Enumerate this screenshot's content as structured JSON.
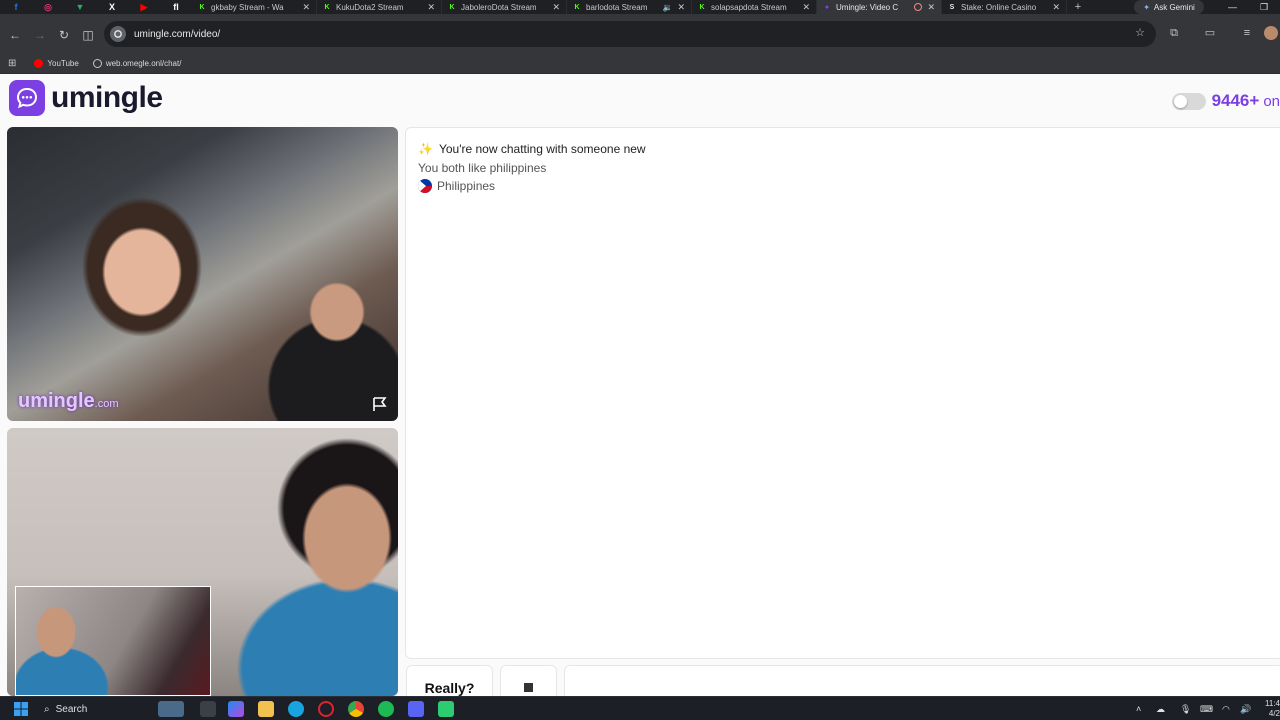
{
  "browser": {
    "pinned_tabs": [
      {
        "icon": "facebook-icon",
        "glyph": "f",
        "color": "#1877f2"
      },
      {
        "icon": "instagram-icon",
        "glyph": "◎",
        "color": "#e1306c"
      },
      {
        "icon": "vpn-shield-icon",
        "glyph": "▼",
        "color": "#27ae60"
      },
      {
        "icon": "x-icon",
        "glyph": "X",
        "color": "#ffffff"
      },
      {
        "icon": "youtube-icon",
        "glyph": "▶",
        "color": "#ff0000"
      },
      {
        "icon": "fb-page-icon",
        "glyph": "fl",
        "color": "#ffffff"
      }
    ],
    "tabs": [
      {
        "title": "gkbaby Stream - Wa",
        "icon": "kick-icon",
        "active": false,
        "audio": false
      },
      {
        "title": "KukuDota2 Stream",
        "icon": "kick-icon",
        "active": false,
        "audio": false
      },
      {
        "title": "JaboleroDota Stream",
        "icon": "kick-icon",
        "active": false,
        "audio": false
      },
      {
        "title": "barlodota Stream",
        "icon": "kick-icon",
        "active": false,
        "audio": true
      },
      {
        "title": "solapsapdota Stream",
        "icon": "kick-icon",
        "active": false,
        "audio": false
      },
      {
        "title": "Umingle: Video C",
        "icon": "umingle-icon",
        "active": true,
        "recording": true
      },
      {
        "title": "Stake: Online Casino",
        "icon": "stake-icon",
        "active": false,
        "audio": false
      }
    ],
    "new_tab_label": "+",
    "gemini_label": "Ask Gemini",
    "url": "umingle.com/video/",
    "bookmarks": [
      {
        "label": "YouTube",
        "icon": "youtube-icon"
      },
      {
        "label": "web.omegle.onl/chat/",
        "icon": "globe-icon"
      }
    ]
  },
  "page": {
    "logo_text": "umingle",
    "online_count": "9446+",
    "online_suffix": "on",
    "watermark": "umingle",
    "watermark_suffix": ".com",
    "chat": {
      "emoji": "✨",
      "headline": "You're now chatting with someone new",
      "shared_interest": "You both like philippines",
      "country": "Philippines"
    },
    "really_label": "Really?",
    "accent_color": "#7b3fe4"
  },
  "taskbar": {
    "search_label": "Search",
    "clock_time": "11:4",
    "clock_date": "4/2"
  }
}
